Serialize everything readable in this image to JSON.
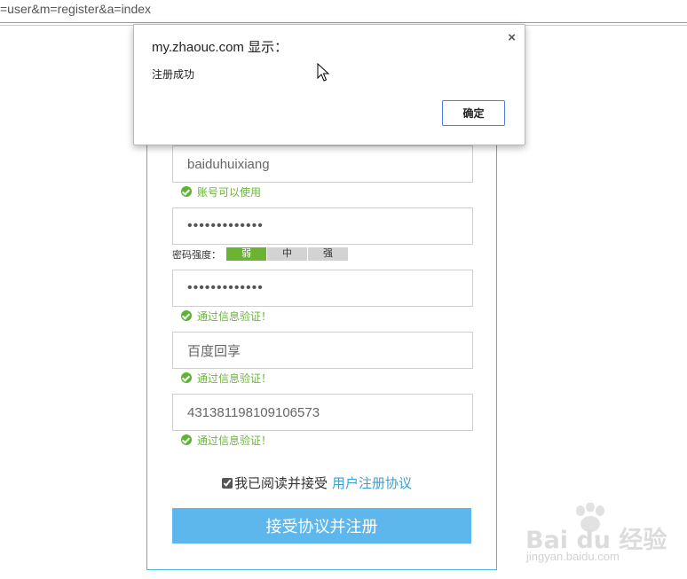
{
  "browser": {
    "url_fragment": "=user&m=register&a=index"
  },
  "dialog": {
    "title": "my.zhaouc.com 显示：",
    "message": "注册成功",
    "ok_label": "确定",
    "close_glyph": "×"
  },
  "form": {
    "username": {
      "value": "baiduhuixiang",
      "status": "账号可以使用"
    },
    "password": {
      "value": "•••••••••••••"
    },
    "strength": {
      "label": "密码强度：",
      "levels": [
        "弱",
        "中",
        "强"
      ],
      "active_level": "弱"
    },
    "confirm_password": {
      "value": "•••••••••••••",
      "status": "通过信息验证！"
    },
    "real_name": {
      "value": "百度回享",
      "status": "通过信息验证！"
    },
    "id_number": {
      "value": "431381198109106573",
      "status": "通过信息验证！"
    },
    "agreement": {
      "checked": true,
      "text": "我已阅读并接受",
      "link": "用户注册协议"
    },
    "submit_label": "接受协议并注册"
  },
  "watermark": {
    "logo_text": "Bai du 经验",
    "url": "jingyan.baidu.com"
  },
  "colors": {
    "panel_border": "#4fb6d6",
    "success_green": "#6db33f",
    "strength_active": "#6bb333",
    "submit_bg": "#5db7ec",
    "link_blue": "#3a9fd8",
    "dialog_ok_border": "#4f7ee8"
  }
}
